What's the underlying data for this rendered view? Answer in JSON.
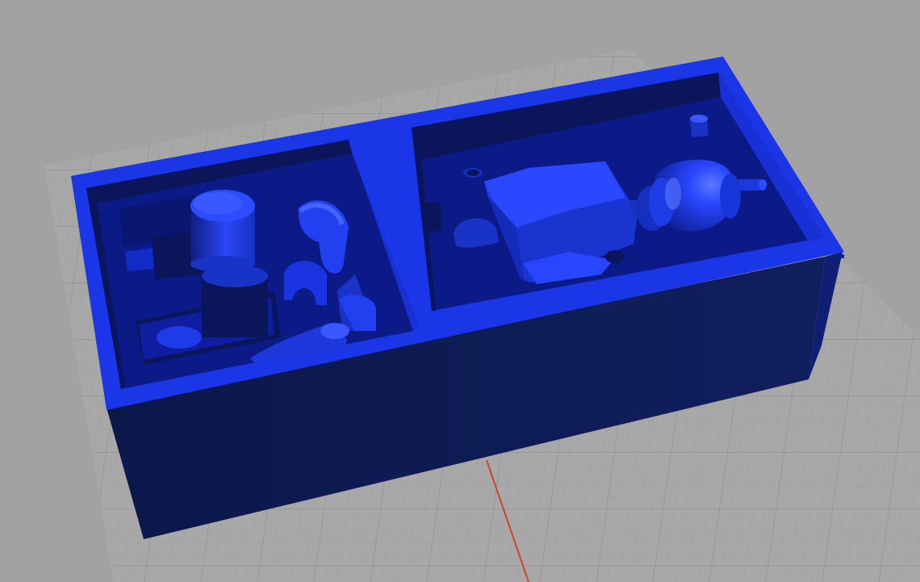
{
  "viewport": {
    "background_color": "#a2a2a2",
    "grid_color": "#8e8e8e",
    "grid_minor_color": "#989898",
    "axis_color": "#c8452f"
  },
  "model": {
    "type": "3d-printed storage tray",
    "face_colors": {
      "front": "#0e1a52",
      "right": "#0c1f8a",
      "top_rim": "#1a36e6",
      "floor": "#0c1a88",
      "inner_wall_dark": "#0a155a",
      "inner_wall_light": "#1831d6",
      "part_light": "#2d4cff",
      "part_mid": "#1e37da",
      "part_dark": "#0f1f8e"
    }
  }
}
